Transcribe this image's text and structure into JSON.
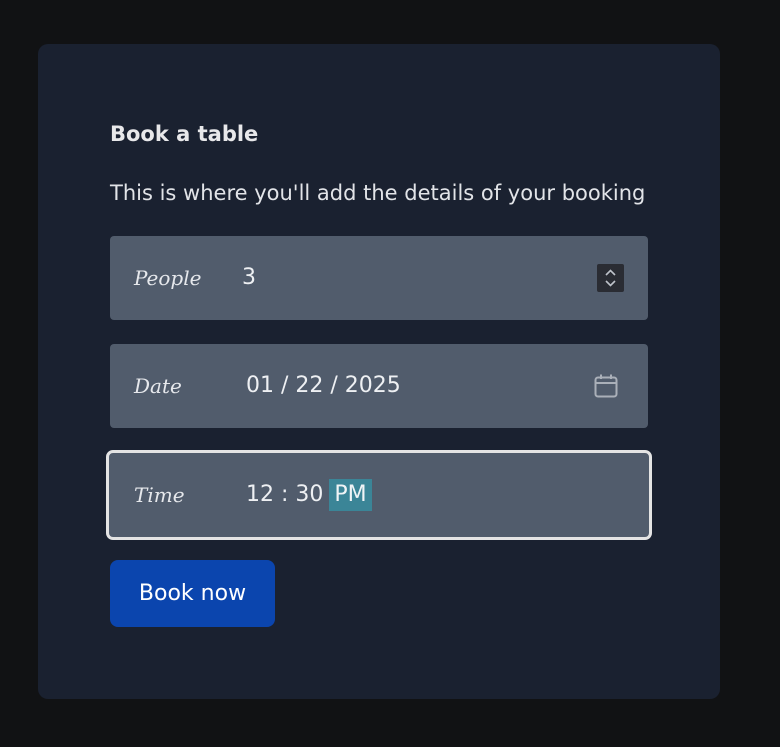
{
  "form": {
    "title": "Book a table",
    "subtitle": "This is where you'll add the details of your booking",
    "people": {
      "label": "People",
      "value": "3",
      "icon": "spinner-icon"
    },
    "date": {
      "label": "Date",
      "value": "01 / 22 / 2025",
      "icon": "calendar-icon"
    },
    "time": {
      "label": "Time",
      "value": "12 : 30",
      "ampm": "PM",
      "focused": true
    },
    "submit_label": "Book now"
  },
  "colors": {
    "page_bg": "#111214",
    "card_bg": "#1a2130",
    "field_bg": "#515c6c",
    "button_bg": "#0b45ae",
    "selection": "#3b8597"
  }
}
